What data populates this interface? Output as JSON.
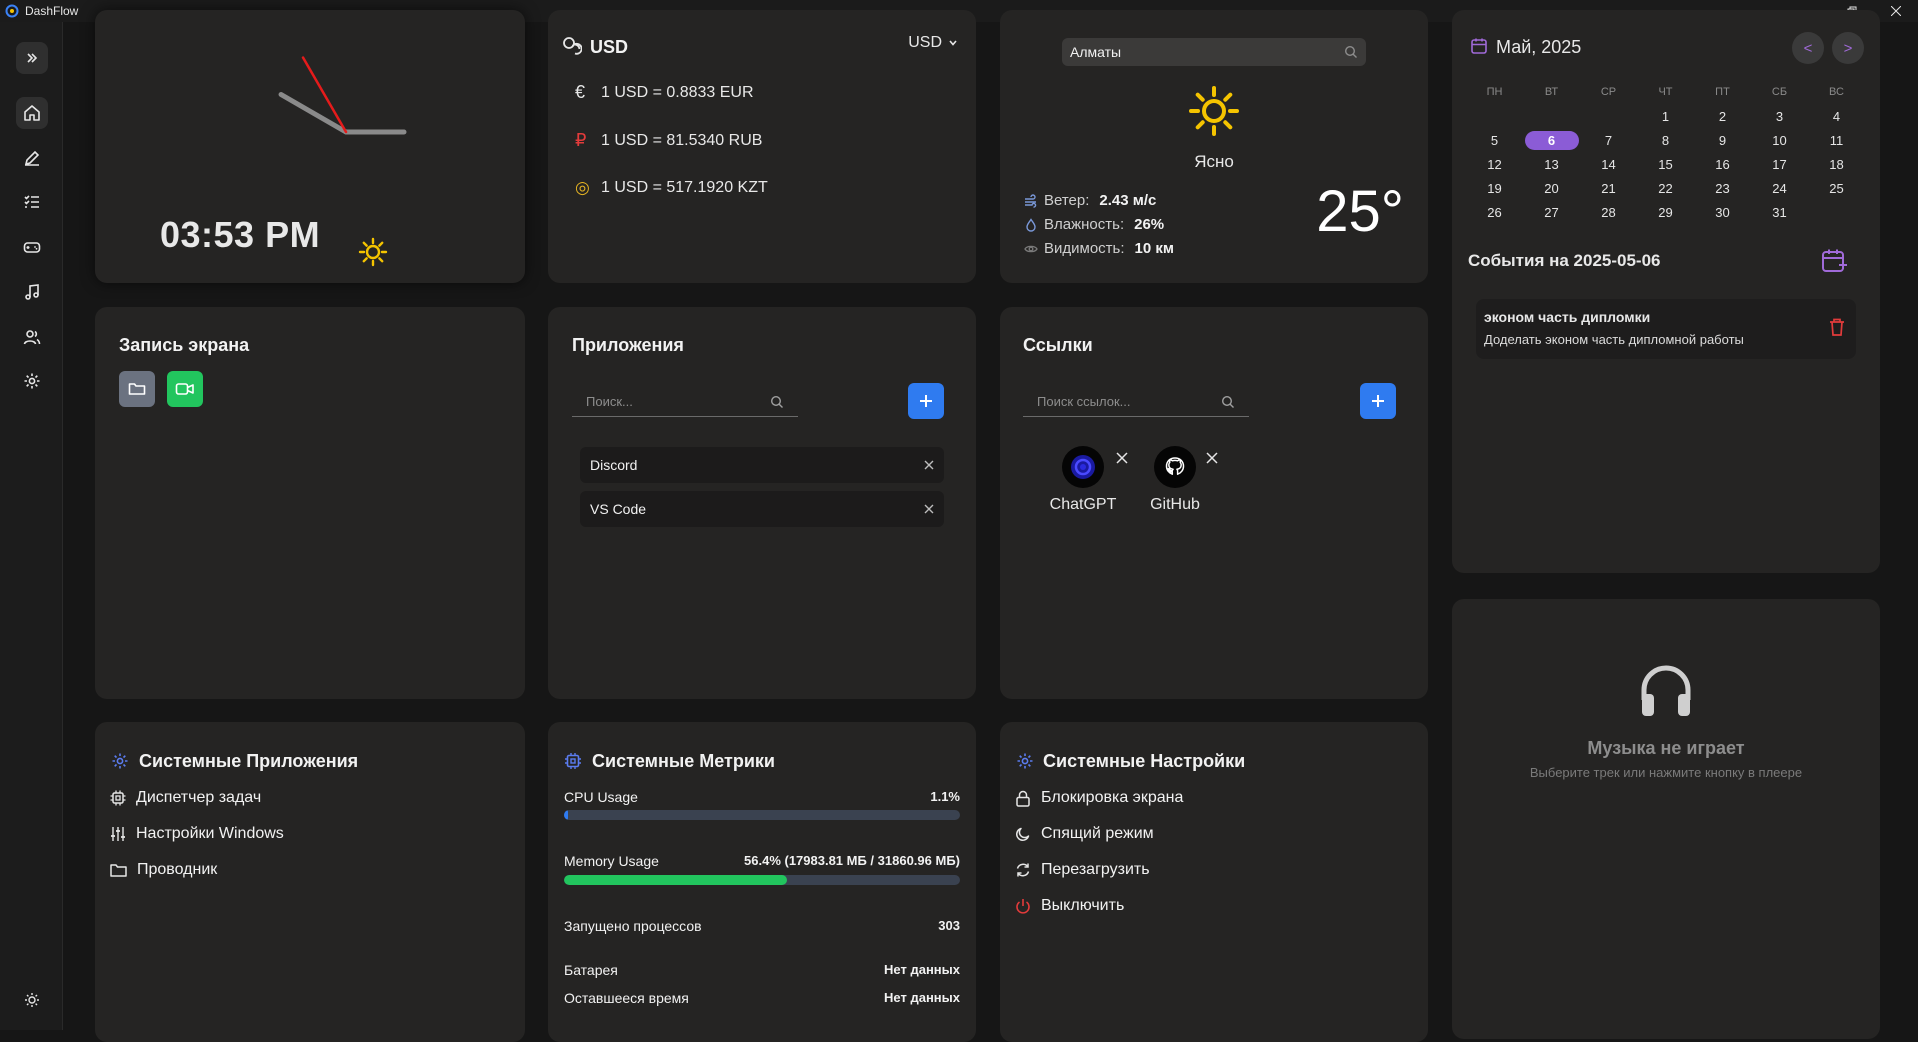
{
  "window": {
    "title": "DashFlow"
  },
  "clock": {
    "time": "03:53 PM",
    "hour_angle_deg": 300,
    "minute_angle_deg": 90,
    "second_angle_deg": 330
  },
  "currency": {
    "base": "USD",
    "select_value": "USD",
    "rates": [
      {
        "symbol": "€",
        "text": "1 USD = 0.8833 EUR",
        "icon": "euro-icon",
        "color": "#e6e6e6"
      },
      {
        "symbol": "₽",
        "text": "1 USD = 81.5340 RUB",
        "icon": "ruble-icon",
        "color": "#e23b3b"
      },
      {
        "symbol": "◎",
        "text": "1 USD = 517.1920 KZT",
        "icon": "coins-icon",
        "color": "#e6b422"
      }
    ]
  },
  "weather": {
    "city": "Алматы",
    "condition": "Ясно",
    "temperature": "25°",
    "wind_label": "Ветер:",
    "wind_value": "2.43 м/с",
    "humidity_label": "Влажность:",
    "humidity_value": "26%",
    "visibility_label": "Видимость:",
    "visibility_value": "10 км"
  },
  "calendar": {
    "month_label": "Май, 2025",
    "prev_label": "<",
    "next_label": ">",
    "weekdays": [
      "ПН",
      "ВТ",
      "СР",
      "ЧТ",
      "ПТ",
      "СБ",
      "ВС"
    ],
    "weeks": [
      [
        "",
        "",
        "",
        "1",
        "2",
        "3",
        "4"
      ],
      [
        "5",
        "6",
        "7",
        "8",
        "9",
        "10",
        "11"
      ],
      [
        "12",
        "13",
        "14",
        "15",
        "16",
        "17",
        "18"
      ],
      [
        "19",
        "20",
        "21",
        "22",
        "23",
        "24",
        "25"
      ],
      [
        "26",
        "27",
        "28",
        "29",
        "30",
        "31",
        ""
      ]
    ],
    "selected_day": "6",
    "events_title": "События на 2025-05-06",
    "events": [
      {
        "title": "эконом часть дипломки",
        "description": "Доделать эконом часть дипломной работы"
      }
    ]
  },
  "music": {
    "title": "Музыка не играет",
    "subtitle": "Выберите трек или нажмите кнопку в плеере"
  },
  "screen_record": {
    "title": "Запись экрана"
  },
  "apps": {
    "title": "Приложения",
    "search_placeholder": "Поиск...",
    "items": [
      "Discord",
      "VS Code"
    ]
  },
  "links": {
    "title": "Ссылки",
    "search_placeholder": "Поиск ссылок...",
    "items": [
      "ChatGPT",
      "GitHub"
    ]
  },
  "system_apps": {
    "title": "Системные Приложения",
    "items": [
      "Диспетчер задач",
      "Настройки Windows",
      "Проводник"
    ]
  },
  "metrics": {
    "title": "Системные Метрики",
    "cpu_label": "CPU Usage",
    "cpu_value": "1.1%",
    "cpu_percent": 1.1,
    "memory_label": "Memory Usage",
    "memory_value": "56.4% (17983.81 МБ / 31860.96 МБ)",
    "memory_percent": 56.4,
    "processes_label": "Запущено процессов",
    "processes_value": "303",
    "battery_label": "Батарея",
    "battery_value": "Нет данных",
    "remaining_label": "Оставшееся время",
    "remaining_value": "Нет данных"
  },
  "system_settings": {
    "title": "Системные Настройки",
    "items": [
      "Блокировка экрана",
      "Спящий режим",
      "Перезагрузить",
      "Выключить"
    ]
  },
  "colors": {
    "accent_blue": "#2f7bf0",
    "accent_purple": "#8b5cd6",
    "green": "#22c55e",
    "sun": "#f5c400"
  }
}
